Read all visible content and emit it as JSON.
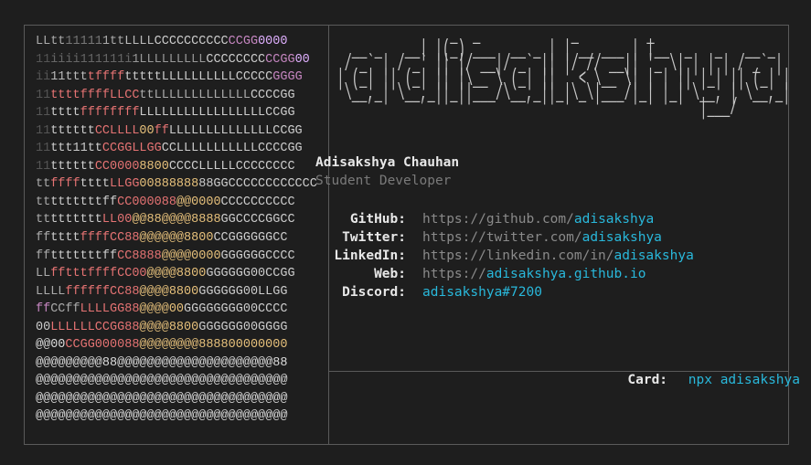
{
  "ascii_art": [
    [
      [
        "#aaaaaa",
        "LLtt"
      ],
      [
        "#777777",
        "11111"
      ],
      [
        "#aaaaaa",
        "1tt"
      ],
      [
        "#bbbbbb",
        "LLLL"
      ],
      [
        "#cccccc",
        "CCCCCCCCCC"
      ],
      [
        "#c586c0",
        "CCGG"
      ],
      [
        "#e0b0ff",
        "0000"
      ]
    ],
    [
      [
        "#555555",
        "11"
      ],
      [
        "#666666",
        "iiii111111i"
      ],
      [
        "#999999",
        "1LLLLLLLLL"
      ],
      [
        "#cccccc",
        "CCCCCCCC"
      ],
      [
        "#c586c0",
        "CCGG"
      ],
      [
        "#e0b0ff",
        "00"
      ]
    ],
    [
      [
        "#555555",
        "ii"
      ],
      [
        "#bbbbbb",
        "11ttt"
      ],
      [
        "#e57373",
        "tffff"
      ],
      [
        "#cccccc",
        "tttttLLLLLLLLLLCCCCC"
      ],
      [
        "#c586c0",
        "GGGG"
      ]
    ],
    [
      [
        "#555555",
        "11"
      ],
      [
        "#e57373",
        "ttttffffLLCC"
      ],
      [
        "#aaaaaa",
        "ttLLLLLLLLLLLLL"
      ],
      [
        "#cccccc",
        "CCCCGG"
      ]
    ],
    [
      [
        "#555555",
        "11"
      ],
      [
        "#cccccc",
        "tttt"
      ],
      [
        "#e57373",
        "ffffffff"
      ],
      [
        "#cccccc",
        "LLLLLLLLLLLLLLLLLCCGG"
      ]
    ],
    [
      [
        "#555555",
        "11"
      ],
      [
        "#cccccc",
        "tttttt"
      ],
      [
        "#e57373",
        "CCLLLL"
      ],
      [
        "#e6c07b",
        "00"
      ],
      [
        "#e57373",
        "ff"
      ],
      [
        "#cccccc",
        "LLLLLLLLLLLLLLCCGG"
      ]
    ],
    [
      [
        "#555555",
        "11"
      ],
      [
        "#cccccc",
        "ttt11tt"
      ],
      [
        "#e57373",
        "CCGGLLGG"
      ],
      [
        "#cccccc",
        "CCLLLLLLLLLLLCCCCGG"
      ]
    ],
    [
      [
        "#555555",
        "11"
      ],
      [
        "#cccccc",
        "tttttt"
      ],
      [
        "#e57373",
        "CC0000"
      ],
      [
        "#e6c07b",
        "8800"
      ],
      [
        "#cccccc",
        "CCCCLLLLLCCCCCCCC"
      ]
    ],
    [
      [
        "#aaaaaa",
        "tt"
      ],
      [
        "#e57373",
        "ffff"
      ],
      [
        "#cccccc",
        "tttt"
      ],
      [
        "#e57373",
        "LLGG"
      ],
      [
        "#e6c07b",
        "00888888"
      ],
      [
        "#cccccc",
        "88GGCCCCCCCCCCCC"
      ]
    ],
    [
      [
        "#aaaaaa",
        "tt"
      ],
      [
        "#cccccc",
        "tttttttff"
      ],
      [
        "#e57373",
        "CC000088"
      ],
      [
        "#e6c07b",
        "@@0000"
      ],
      [
        "#cccccc",
        "CCCCCCCCCC"
      ]
    ],
    [
      [
        "#aaaaaa",
        "tt"
      ],
      [
        "#cccccc",
        "ttttttt"
      ],
      [
        "#e57373",
        "LL00"
      ],
      [
        "#e6c07b",
        "@@88@@@@8888"
      ],
      [
        "#cccccc",
        "GGCCCCGGCC"
      ]
    ],
    [
      [
        "#aaaaaa",
        "ff"
      ],
      [
        "#cccccc",
        "tttt"
      ],
      [
        "#e57373",
        "ffffCC88"
      ],
      [
        "#e6c07b",
        "@@@@@@8800"
      ],
      [
        "#cccccc",
        "CCGGGGGGCC"
      ]
    ],
    [
      [
        "#aaaaaa",
        "ff"
      ],
      [
        "#cccccc",
        "tttttttff"
      ],
      [
        "#e57373",
        "CC8888"
      ],
      [
        "#e6c07b",
        "@@@@0000"
      ],
      [
        "#cccccc",
        "GGGGGGCCCC"
      ]
    ],
    [
      [
        "#aaaaaa",
        "LL"
      ],
      [
        "#e57373",
        "fftttffffCC00"
      ],
      [
        "#e6c07b",
        "@@@@8800"
      ],
      [
        "#cccccc",
        "GGGGGG00CCGG"
      ]
    ],
    [
      [
        "#aaaaaa",
        "LLLL"
      ],
      [
        "#e57373",
        "ffffffCC88"
      ],
      [
        "#e6c07b",
        "@@@@8800"
      ],
      [
        "#cccccc",
        "GGGGGG00LLGG"
      ]
    ],
    [
      [
        "#c586c0",
        "ff"
      ],
      [
        "#aaaaaa",
        "CCff"
      ],
      [
        "#e57373",
        "LLLLGG88"
      ],
      [
        "#e6c07b",
        "@@@@00"
      ],
      [
        "#cccccc",
        "GGGGGGGG00CCCC"
      ]
    ],
    [
      [
        "#cccccc",
        "00"
      ],
      [
        "#e57373",
        "LLLLLLCCGG88"
      ],
      [
        "#e6c07b",
        "@@@@8800"
      ],
      [
        "#cccccc",
        "GGGGGG00GGGG"
      ]
    ],
    [
      [
        "#dddddd",
        "@@00"
      ],
      [
        "#e57373",
        "CCGG000088"
      ],
      [
        "#e6c07b",
        "@@@@@@@@888800000000"
      ]
    ],
    [
      [
        "#dddddd",
        "@@@@@@@@@88@@@@@@@@@@@@@@@@@@@@@88"
      ]
    ],
    [
      [
        "#dddddd",
        "@@@@@@@@@@@@@@@@@@@@@@@@@@@@@@@@@@"
      ]
    ],
    [
      [
        "#dddddd",
        "@@@@@@@@@@@@@@@@@@@@@@@@@@@@@@@@@@"
      ]
    ],
    [
      [
        "#dddddd",
        "@@@@@@@@@@@@@@@@@@@@@@@@@@@@@@@@@@"
      ]
    ]
  ],
  "banner_lines": [
    "                _  _            _         _                       ",
    "   __ _   __| |(_) ___  __ _ | | __ ___ | |__  _   _   __ _ ",
    "  / _` | / _` || |/ __|/ _` || |/ // __|| '_ \\| | | | / _` |",
    " | (_| || (_| || |\\__ \\ (_| ||   < \\__ \\| | | || |_| || (_| |",
    "  \\__,_| \\__,_||_||___/\\__,_||_|\\_\\|___/|_| |_| \\__, | \\__,_|",
    "                                                 |___/        "
  ],
  "profile": {
    "name": "Adisakshya Chauhan",
    "role": "Student Developer"
  },
  "links": [
    {
      "label": "GitHub:",
      "prefix": "https://github.com/",
      "handle": "adisakshya"
    },
    {
      "label": "Twitter:",
      "prefix": "https://twitter.com/",
      "handle": "adisakshya"
    },
    {
      "label": "LinkedIn:",
      "prefix": "https://linkedin.com/in/",
      "handle": "adisakshya"
    },
    {
      "label": "Web:",
      "prefix": "https://",
      "handle": "adisakshya.github.io"
    },
    {
      "label": "Discord:",
      "prefix": "",
      "handle": "adisakshya#7200"
    }
  ],
  "footer": {
    "label": "Card:",
    "command": "npx adisakshya"
  },
  "colors": {
    "background": "#1e1e1e",
    "border": "#5a5a5a",
    "accent": "#29b8db",
    "muted": "#8a8a8a"
  }
}
